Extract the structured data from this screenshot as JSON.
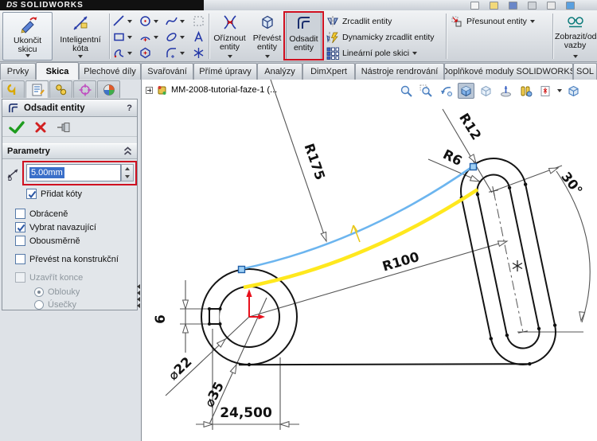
{
  "titlebar": {
    "logo_ds": "DS",
    "logo_rest": "SOLIDWORKS"
  },
  "toolbar": {
    "exit_l1": "Ukončit",
    "exit_l2": "skicu",
    "smartdim_l1": "Inteligentní",
    "smartdim_l2": "kóta",
    "trim_l1": "Oříznout",
    "trim_l2": "entity",
    "convert_l1": "Převést",
    "convert_l2": "entity",
    "offset_l1": "Odsadit",
    "offset_l2": "entity",
    "mirror": "Zrcadlit entity",
    "dyn_mirror": "Dynamicky zrcadlit entity",
    "linear_pattern": "Lineární pole skici",
    "move": "Přesunout entity",
    "relations_l1": "Zobrazit/odst",
    "relations_l2": "vazby"
  },
  "tabs": {
    "t0": "Prvky",
    "t1": "Skica",
    "t2": "Plechové díly",
    "t3": "Svařování",
    "t4": "Přímé úpravy",
    "t5": "Analýzy",
    "t6": "DimXpert",
    "t7": "Nástroje rendrování",
    "t8": "Doplňkové moduly SOLIDWORKS",
    "t9": "SOL"
  },
  "tree": {
    "label": "MM-2008-tutorial-faze-1 (..."
  },
  "panel": {
    "title": "Odsadit entity",
    "help": "?",
    "params_header": "Parametry",
    "offset_value": "5.00mm",
    "cb_add_dims": "Přidat kóty",
    "cb_reverse": "Obráceně",
    "cb_select_chain": "Vybrat navazující",
    "cb_bidirectional": "Obousměrně",
    "cb_construction": "Převést na konstrukční",
    "cb_cap_ends": "Uzavřít konce",
    "radio_arcs": "Oblouky",
    "radio_lines": "Úsečky"
  },
  "states": {
    "add_dims_checked": true,
    "reverse_checked": false,
    "select_chain_checked": true,
    "bidirectional_checked": false,
    "construction_checked": false,
    "cap_ends_checked": false,
    "cap_ends_enabled": false,
    "arcs_selected": true,
    "lines_selected": false,
    "active_tab": "Skica",
    "active_tool": "Odsadit entity"
  },
  "drawing": {
    "r175": "R175",
    "r12": "R12",
    "r6": "R6",
    "r100": "R100",
    "angle30": "30°",
    "dia22": "⌀22",
    "dia35": "⌀35",
    "key_width": "6",
    "dist": "24,500"
  },
  "colors": {
    "selection_blue": "#3a6fc9",
    "annotation_red": "#cf1020",
    "curve_blue": "#6cb5ef",
    "curve_yellow": "#ffe81e",
    "origin_red": "#e8101c"
  }
}
